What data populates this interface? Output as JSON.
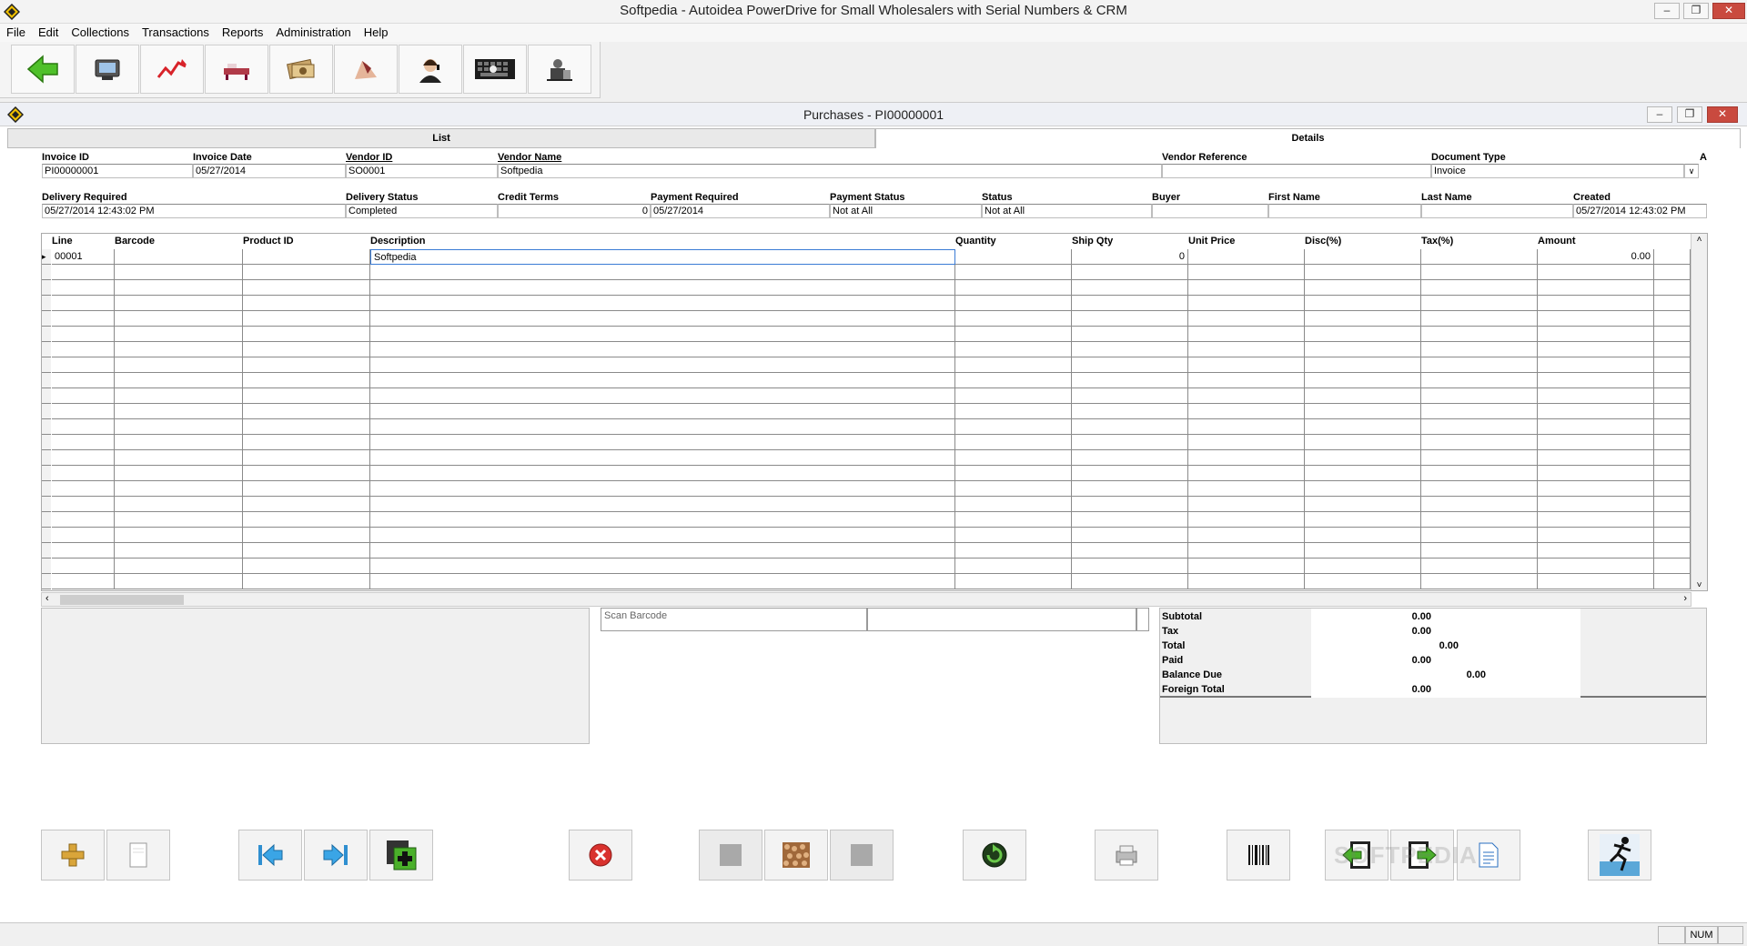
{
  "window": {
    "title": "Softpedia - Autoidea PowerDrive for Small Wholesalers with Serial Numbers & CRM"
  },
  "menu": [
    "File",
    "Edit",
    "Collections",
    "Transactions",
    "Reports",
    "Administration",
    "Help"
  ],
  "toolbar": [
    "back-arrow-icon",
    "pos-terminal-icon",
    "sales-chart-icon",
    "delivery-icon",
    "money-icon",
    "handshake-icon",
    "customer-support-icon",
    "keyboard-icon",
    "administration-icon"
  ],
  "child": {
    "title": "Purchases - PI00000001",
    "tabs": {
      "list": "List",
      "details": "Details"
    }
  },
  "header1": {
    "labels": [
      "Invoice ID",
      "Invoice Date",
      "Vendor ID",
      "Vendor Name",
      "Vendor Reference",
      "Document Type",
      "A"
    ],
    "values": {
      "invoice_id": "PI00000001",
      "invoice_date": "05/27/2014",
      "vendor_id": "SO0001",
      "vendor_name": "Softpedia",
      "vendor_reference": "",
      "document_type": "Invoice"
    }
  },
  "header2": {
    "labels": [
      "Delivery Required",
      "Delivery Status",
      "Credit Terms",
      "Payment Required",
      "Payment Status",
      "Status",
      "Buyer",
      "First Name",
      "Last Name",
      "Created"
    ],
    "values": {
      "delivery_required": "05/27/2014 12:43:02 PM",
      "delivery_status": "Completed",
      "credit_terms": "0",
      "payment_required": "05/27/2014",
      "payment_status": "Not at All",
      "status": "Not at All",
      "buyer": "",
      "first_name": "",
      "last_name": "",
      "created": "05/27/2014 12:43:02 PM"
    }
  },
  "lines": {
    "columns": [
      "Line",
      "Barcode",
      "Product ID",
      "Description",
      "Quantity",
      "Ship Qty",
      "Unit Price",
      "Disc(%)",
      "Tax(%)",
      "Amount"
    ],
    "rows": [
      {
        "line": "00001",
        "barcode": "",
        "product_id": "",
        "description": "Softpedia",
        "quantity": "",
        "ship_qty": "0",
        "unit_price": "",
        "disc": "",
        "tax": "",
        "amount": "0.00"
      }
    ]
  },
  "scan": {
    "label": "Scan Barcode"
  },
  "totals": [
    {
      "label": "Subtotal",
      "value": "0.00"
    },
    {
      "label": "Tax",
      "value": "0.00"
    },
    {
      "label": "Total",
      "value": "0.00"
    },
    {
      "label": "Paid",
      "value": "0.00"
    },
    {
      "label": "Balance Due",
      "value": "0.00"
    },
    {
      "label": "Foreign Total",
      "value": "0.00"
    }
  ],
  "actions": [
    "add-icon",
    "blank-document-icon",
    "first-record-icon",
    "last-record-icon",
    "new-record-icon",
    "delete-icon",
    "gray-square-icon",
    "texture-icon",
    "gray-square-icon",
    "refresh-icon",
    "printer-icon",
    "barcode-icon",
    "import-icon",
    "export-icon",
    "document-icon",
    "exit-running-man-icon"
  ],
  "status": {
    "num": "NUM"
  },
  "watermark": "SOFTPEDIA"
}
